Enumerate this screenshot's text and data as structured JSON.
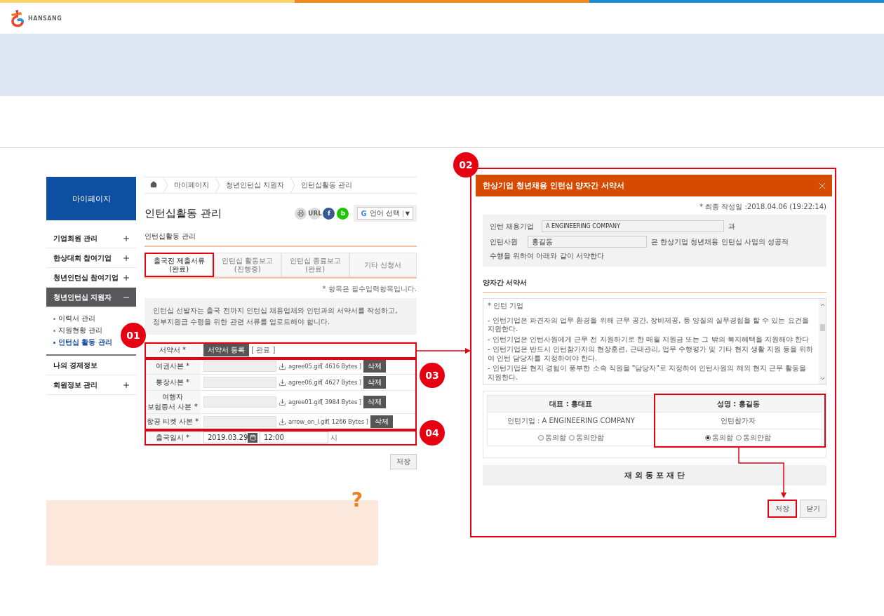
{
  "header": {
    "logo_text": "HANSANG"
  },
  "sidebar": {
    "title": "마이페이지",
    "items": [
      {
        "kind": "group",
        "label": "기업회원 관리",
        "expanded": false
      },
      {
        "kind": "group",
        "label": "한상대회 참여기업",
        "expanded": false
      },
      {
        "kind": "group",
        "label": "청년인턴십 참여기업",
        "expanded": false
      },
      {
        "kind": "group",
        "label": "청년인턴십 지원자",
        "expanded": true,
        "children": [
          {
            "label": "이력서 관리",
            "selected": false
          },
          {
            "label": "지원현황 관리",
            "selected": false
          },
          {
            "label": "인턴십 활동 관리",
            "selected": true
          }
        ]
      },
      {
        "kind": "link",
        "label": "나의 경제정보"
      },
      {
        "kind": "group",
        "label": "회원정보 관리",
        "expanded": false
      }
    ]
  },
  "breadcrumb": [
    "마이페이지",
    "청년인턴십 지원자",
    "인턴십활동 관리"
  ],
  "page_title": "인턴십활동 관리",
  "share_buttons": [
    {
      "kind": "print"
    },
    {
      "kind": "url",
      "label": "URL"
    },
    {
      "kind": "facebook",
      "label": "f"
    },
    {
      "kind": "blog",
      "label": "b"
    }
  ],
  "language_select": {
    "logo": "G",
    "label": "언어 선택",
    "arrow": "▼"
  },
  "section_title": "인턴십활동 관리",
  "tabs": [
    {
      "label": "출국전 제출서류",
      "status": "(완료)",
      "selected": true
    },
    {
      "label": "인턴십 활동보고",
      "status": "(진행중)",
      "selected": false
    },
    {
      "label": "인턴십 종료보고",
      "status": "(완료)",
      "selected": false
    },
    {
      "label": "기타 신청서",
      "selected": false
    }
  ],
  "required_note": "* 항목은 필수입력항목입니다.",
  "notice": [
    "인턴십 선발자는 출국 전까지 인턴십 채용업체와 인턴과의 서약서를 작성하고,",
    "정부지원금 수령을 위한 관련 서류를 업로드해야 합니다."
  ],
  "form_groups": [
    {
      "marker": "01",
      "rows": [
        {
          "kind": "pledge",
          "label": "서약서 *",
          "button": "서약서 등록",
          "status": "[ 완료 ]"
        }
      ]
    },
    {
      "marker": "03",
      "rows": [
        {
          "kind": "file",
          "label": "여권사본 *",
          "file": "agree05.gif[ 4616 Bytes ]",
          "delete": "삭제"
        },
        {
          "kind": "file",
          "label": "통장사본 *",
          "file": "agree06.gif[ 4627 Bytes ]",
          "delete": "삭제"
        },
        {
          "kind": "file",
          "label": "여행자\n보험증서 사본 *",
          "file": "agree01.gif[ 3984 Bytes ]",
          "delete": "삭제"
        },
        {
          "kind": "file",
          "label": "항공 티켓 사본 *",
          "file": "arrow_on_l.gif[ 1266 Bytes ]",
          "delete": "삭제"
        }
      ]
    },
    {
      "marker": "04",
      "rows": [
        {
          "kind": "datetime",
          "label": "출국일시 *",
          "date": "2019.03.29",
          "time": "12:00",
          "unit": "시"
        }
      ]
    }
  ],
  "save_button": "저장",
  "help_box": {
    "icon": "?"
  },
  "modal": {
    "marker": "02",
    "title": "한상기업 청년채용 인턴십 양자간 서약서",
    "last_written": "* 최종 작성일 :2018.04.06 (19:22:14)",
    "company_label": "인턴 채용기업",
    "company_value": "A ENGINEERING COMPANY",
    "company_suffix": "과",
    "intern_label": "인턴사원",
    "intern_value": "홍길동",
    "intern_suffix": "은 한상기업 청년채용 인턴십 사업의 성공적",
    "sentence_end": "수행을 위하여 아래와 같이 서약한다",
    "agreement_title": "양자간 서약서",
    "agreement_heading": "* 인턴 기업",
    "agreement_lines": [
      "- 인턴기업은 파견자의 업무 환경을 위해 근무 공간, 장비제공, 등 양질의 실무경험을 할 수 있는 요건을 지원한다.",
      "- 인턴기업은 인턴사원에게 근무 전 지원하기로 한 매월 지원금 또는 그 밖의 복지혜택을 지원해야 한다",
      "- 인턴기업은 반드시 인턴참가자의 현장훈련, 근태관리, 업무 수행평가 및 기타 현지 생활 지원 등을 위하여 인턴 담당자를 지정하여야 한다.",
      "- 인턴기업은 현지 경험이 풍부한 소속 직원을 \"담당자\"로 지정하여 인턴사원의 해외 현지 근무 활동을 지원한다."
    ],
    "signatures": [
      {
        "header": "대표 : 홍대표",
        "role": "인턴기업 : A ENGINEERING COMPANY",
        "highlighted": false,
        "options": [
          {
            "label": "동의함",
            "selected": false
          },
          {
            "label": "동의안함",
            "selected": false
          }
        ]
      },
      {
        "header": "성명 : 홍길동",
        "role": "인턴참가자",
        "highlighted": true,
        "options": [
          {
            "label": "동의함",
            "selected": true
          },
          {
            "label": "동의안함",
            "selected": false
          }
        ]
      }
    ],
    "organization": "재 외 동 포 재 단",
    "buttons": [
      {
        "label": "저장",
        "highlighted": true
      },
      {
        "label": "닫기",
        "highlighted": false
      }
    ]
  }
}
